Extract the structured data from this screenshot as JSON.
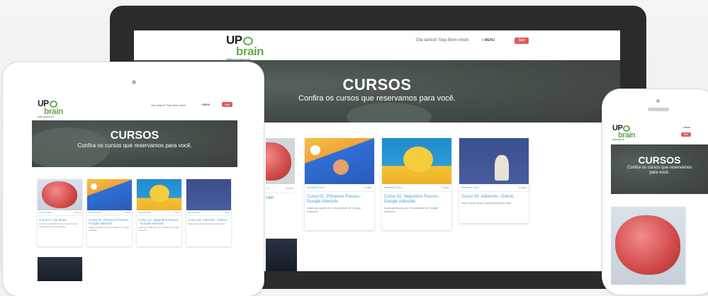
{
  "brand": {
    "logo_up": "UP",
    "logo_brain": "brain",
    "logo_sub": "plataforma de treinamento",
    "accent": "#6aa84f",
    "link_color": "#4aa3c9",
    "logout_color": "#e05a5a"
  },
  "header": {
    "tagline": "Ola tarlisol! Seja Bem-vindo",
    "menu_label": "MENU",
    "logout_label": "Sair"
  },
  "hero": {
    "title": "CURSOS",
    "subtitle": "Confira os cursos que reservamos para você."
  },
  "courses": [
    {
      "date": "Novembro 2014",
      "duration": "00:00:00",
      "title": "O que é o Up Brain",
      "title_partial": "rain",
      "desc": "Conheça a plataforma de treinamento da Tecnologia e Zeno Soluções.",
      "thumb": "brain"
    },
    {
      "date": "Novembro 2014",
      "duration": "5 aulas",
      "title": "Curso 01: Primeiros Passos - Google Adwords",
      "desc": "Aulas gravadas da Comunidade de Google Adwords.",
      "thumb": "doodle1"
    },
    {
      "date": "Novembro 2014",
      "duration": "5 aulas",
      "title": "Curso 02: Segundos Passos - Google Adwords",
      "desc": "Aulas gravadas da Comunidade de Google Adwords.",
      "thumb": "doodle2"
    },
    {
      "date": "Novembro 2014",
      "duration": "5 aulas",
      "title": "Curso 03: Adwords - Outros",
      "desc": "Veja outras aulas complementares aqui.",
      "thumb": "doodle3"
    }
  ]
}
